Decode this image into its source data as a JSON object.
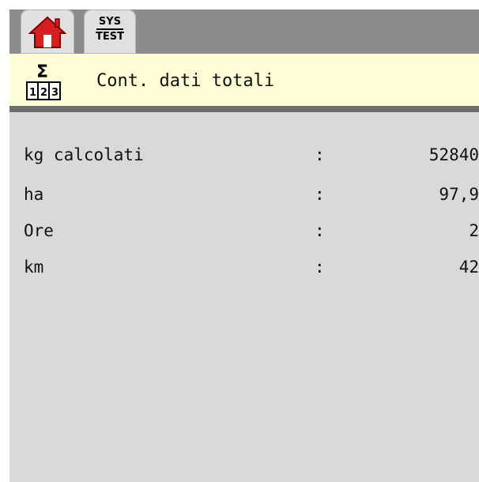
{
  "toolbar": {
    "home_icon": "home-icon",
    "sys_test": {
      "top": "SYS",
      "bottom": "TEST"
    }
  },
  "header": {
    "icon": "sum-counter-icon",
    "icon_symbol": "Σ",
    "icon_digits": [
      "1",
      "2",
      "3"
    ],
    "title": "Cont. dati totali"
  },
  "rows": [
    {
      "label": "kg calcolati",
      "sep": ":",
      "value": "52840"
    },
    {
      "label": "ha",
      "sep": ":",
      "value": "97,9"
    },
    {
      "label": "Ore",
      "sep": ":",
      "value": "2"
    },
    {
      "label": "km",
      "sep": ":",
      "value": "42"
    }
  ],
  "colors": {
    "topbar": "#8c8c8c",
    "title_bar": "#fffcd6",
    "content_bg": "#d9d9d9",
    "home_icon_red": "#d42020"
  }
}
